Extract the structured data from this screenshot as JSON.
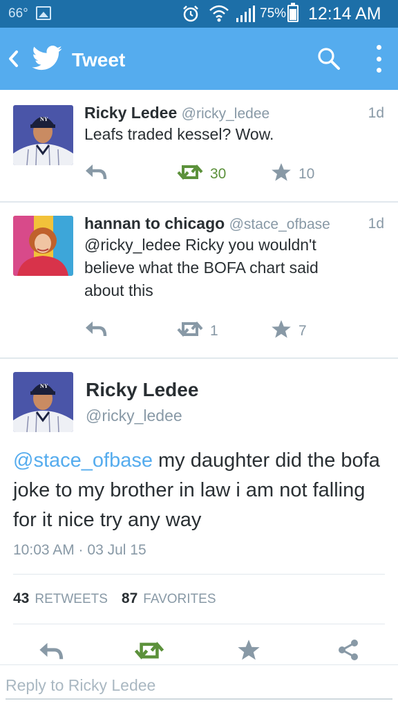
{
  "status_bar": {
    "temperature": "66°",
    "battery_percent": "75%",
    "battery_level": 0.75,
    "time": "12:14 AM",
    "icons": [
      "gallery-icon",
      "alarm-icon",
      "wifi-icon",
      "signal-icon",
      "battery-icon"
    ]
  },
  "action_bar": {
    "title": "Tweet",
    "icons": [
      "back-icon",
      "twitter-bird-icon",
      "search-icon",
      "overflow-menu-icon"
    ]
  },
  "colors": {
    "status_bar": "#1d6fa8",
    "action_bar": "#55acee",
    "retweet_green": "#5c913b",
    "muted": "#8899a6",
    "link": "#55acee"
  },
  "tweets": [
    {
      "name": "Ricky Ledee",
      "handle": "@ricky_ledee",
      "age": "1d",
      "text": "Leafs traded kessel? Wow.",
      "retweets": "30",
      "favorites": "10"
    },
    {
      "name": "hannan to chicago",
      "handle": "@stace_ofbase",
      "age": "1d",
      "text": "@ricky_ledee Ricky you wouldn't believe what the BOFA chart said about this",
      "retweets": "1",
      "favorites": "7"
    }
  ],
  "detail": {
    "name": "Ricky Ledee",
    "handle": "@ricky_ledee",
    "mention": "@stace_ofbase",
    "text": " my daughter did the bofa joke to my brother in law i am not falling for it nice try any way",
    "timestamp": "10:03 AM · 03 Jul 15",
    "retweets_count": "43",
    "retweets_label": "RETWEETS",
    "favorites_count": "87",
    "favorites_label": "FAVORITES"
  },
  "reply": {
    "placeholder": "Reply to Ricky Ledee"
  }
}
